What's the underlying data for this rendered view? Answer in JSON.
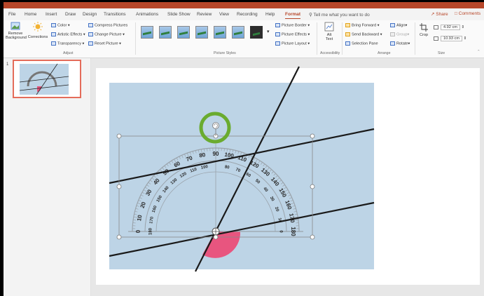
{
  "tabs": [
    {
      "label": "File"
    },
    {
      "label": "Home"
    },
    {
      "label": "Insert"
    },
    {
      "label": "Draw"
    },
    {
      "label": "Design"
    },
    {
      "label": "Transitions"
    },
    {
      "label": "Animations"
    },
    {
      "label": "Slide Show"
    },
    {
      "label": "Review"
    },
    {
      "label": "View"
    },
    {
      "label": "Recording"
    },
    {
      "label": "Help"
    },
    {
      "label": "Format"
    }
  ],
  "tell_me": "Tell me what you want to do",
  "share": "Share",
  "comments": "Comments",
  "ribbon": {
    "adjust": {
      "remove_background": [
        "Remove",
        "Background"
      ],
      "corrections": "Corrections",
      "color": "Color",
      "artistic_effects": "Artistic Effects",
      "transparency": "Transparency",
      "compress_pictures": "Compress Pictures",
      "change_picture": "Change Picture",
      "reset_picture": "Reset Picture",
      "group_label": "Adjust"
    },
    "picture_styles": {
      "picture_border": "Picture Border",
      "picture_effects": "Picture Effects",
      "picture_layout": "Picture Layout",
      "group_label": "Picture Styles"
    },
    "accessibility": {
      "alt_text": [
        "Alt",
        "Text"
      ],
      "group_label": "Accessibility"
    },
    "arrange": {
      "bring_forward": "Bring Forward",
      "send_backward": "Send Backward",
      "selection_pane": "Selection Pane",
      "align": "Align",
      "group": "Group",
      "rotate": "Rotate",
      "group_label": "Arrange"
    },
    "size": {
      "crop": "Crop",
      "height": "4.92 cm",
      "width": "10.93 cm",
      "group_label": "Size"
    }
  },
  "slide_panel": {
    "slide_number": "1"
  },
  "protractor": {
    "outer_labels": [
      "0",
      "10",
      "20",
      "30",
      "40",
      "50",
      "60",
      "70",
      "80",
      "90",
      "100",
      "110",
      "120",
      "130",
      "140",
      "150",
      "160",
      "170",
      "180"
    ],
    "inner_labels": [
      "180",
      "170",
      "160",
      "150",
      "140",
      "130",
      "120",
      "110",
      "100",
      "80",
      "70",
      "60",
      "50",
      "40",
      "30",
      "20",
      "10",
      "0"
    ]
  },
  "colors": {
    "accent": "#b7472a",
    "picture_background": "#bdd4e6",
    "sector_fill": "#e8557f",
    "rotation_highlight": "#6aab2f"
  }
}
